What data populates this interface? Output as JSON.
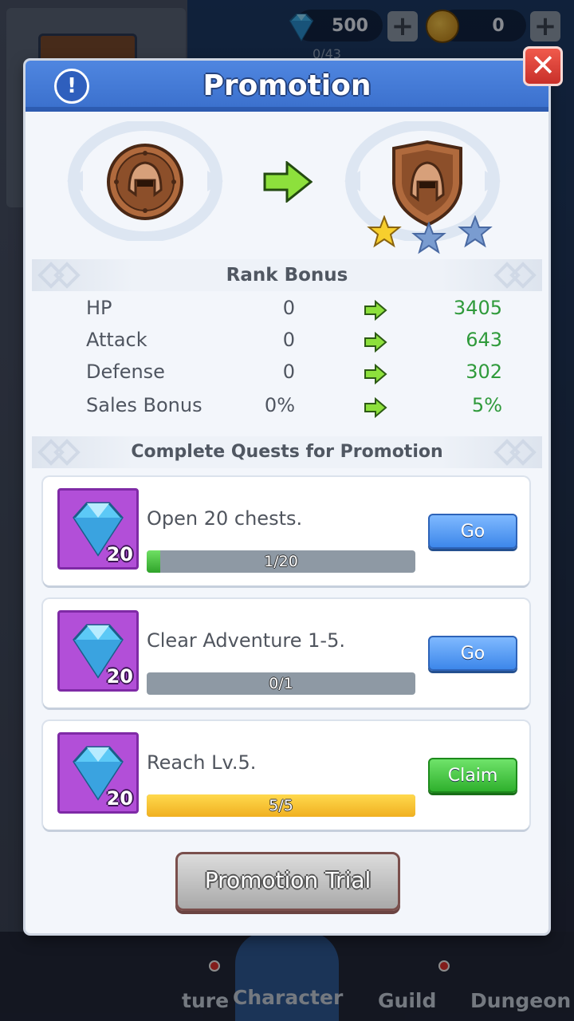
{
  "background": {
    "currency": {
      "gems": "500",
      "coins": "0",
      "progress": "0/43"
    },
    "nav": [
      {
        "label": "ture"
      },
      {
        "label": "Character"
      },
      {
        "label": "Guild"
      },
      {
        "label": "Dungeon"
      }
    ]
  },
  "modal": {
    "title": "Promotion",
    "info_icon": "info-icon",
    "close_icon": "close-icon",
    "rank": {
      "current_icon": "bronze-helmet-coin-icon",
      "next_icon": "bronze-helmet-shield-icon",
      "next_stars_filled": 1,
      "next_stars_total": 3
    },
    "rank_bonus": {
      "title": "Rank Bonus",
      "rows": [
        {
          "label": "HP",
          "from": "0",
          "to": "3405"
        },
        {
          "label": "Attack",
          "from": "0",
          "to": "643"
        },
        {
          "label": "Defense",
          "from": "0",
          "to": "302"
        },
        {
          "label": "Sales Bonus",
          "from": "0%",
          "to": "5%"
        }
      ]
    },
    "quests": {
      "title": "Complete Quests for Promotion",
      "items": [
        {
          "text": "Open 20 chests.",
          "reward": "20",
          "progress_text": "1/20",
          "progress": 0.05,
          "bar": "green",
          "button": "Go",
          "button_type": "go"
        },
        {
          "text": "Clear Adventure 1-5.",
          "reward": "20",
          "progress_text": "0/1",
          "progress": 0,
          "bar": "green",
          "button": "Go",
          "button_type": "go"
        },
        {
          "text": "Reach Lv.5.",
          "reward": "20",
          "progress_text": "5/5",
          "progress": 1,
          "bar": "yellow",
          "button": "Claim",
          "button_type": "claim"
        }
      ]
    },
    "trial_button": "Promotion Trial"
  },
  "colors": {
    "header_blue": "#3a6fcc",
    "bonus_green": "#2f9a3b",
    "reward_purple": "#b24fd8",
    "button_blue": "#3d87ea",
    "button_green": "#2fb02d"
  }
}
